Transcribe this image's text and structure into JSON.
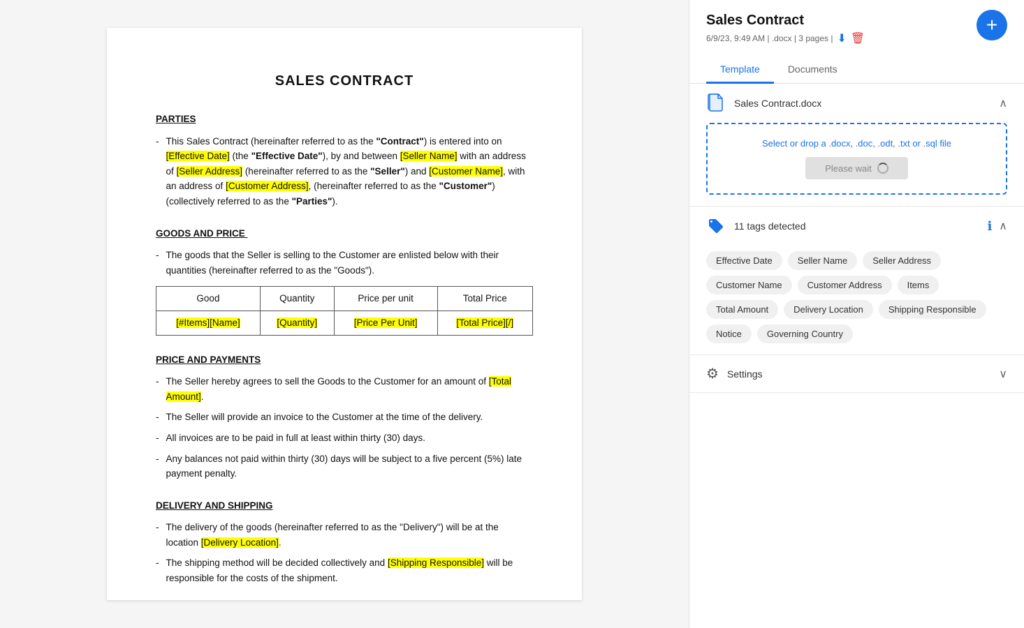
{
  "sidebar": {
    "title": "Sales Contract",
    "meta": "6/9/23, 9:49 AM | .docx | 3 pages |",
    "add_button_label": "+",
    "tabs": [
      {
        "id": "template",
        "label": "Template",
        "active": true
      },
      {
        "id": "documents",
        "label": "Documents",
        "active": false
      }
    ],
    "file_section": {
      "filename": "Sales Contract.docx",
      "upload_text": "Select or drop a .docx, .doc, .odt, .txt or .sql file",
      "wait_button": "Please wait"
    },
    "tags_section": {
      "count_label": "11 tags detected",
      "tags": [
        "Effective Date",
        "Seller Name",
        "Seller Address",
        "Customer Name",
        "Customer Address",
        "Items",
        "Total Amount",
        "Delivery Location",
        "Shipping Responsible",
        "Notice",
        "Governing Country"
      ]
    },
    "settings_section": {
      "label": "Settings"
    }
  },
  "document": {
    "title": "SALES CONTRACT",
    "sections": [
      {
        "heading": "PARTIES",
        "bullets": [
          {
            "text_parts": [
              {
                "text": "This Sales Contract (hereinafter referred to as the ",
                "highlight": false
              },
              {
                "text": "“Contract”",
                "highlight": false,
                "bold": true
              },
              {
                "text": ") is entered into on ",
                "highlight": false
              },
              {
                "text": "[Effective Date]",
                "highlight": true
              },
              {
                "text": " (the ",
                "highlight": false
              },
              {
                "text": "“Effective Date”",
                "highlight": false,
                "bold": true
              },
              {
                "text": "), by and between ",
                "highlight": false
              },
              {
                "text": "[Seller Name]",
                "highlight": true
              },
              {
                "text": " with an address of ",
                "highlight": false
              },
              {
                "text": "[Seller Address]",
                "highlight": true
              },
              {
                "text": " (hereinafter referred to as the ",
                "highlight": false
              },
              {
                "text": "“Seller”",
                "highlight": false,
                "bold": true
              },
              {
                "text": ") and ",
                "highlight": false
              },
              {
                "text": "[Customer Name]",
                "highlight": true
              },
              {
                "text": ", with an address of ",
                "highlight": false
              },
              {
                "text": "[Customer Address]",
                "highlight": true
              },
              {
                "text": ", (hereinafter referred to as the ",
                "highlight": false
              },
              {
                "text": "“Customer”",
                "highlight": false,
                "bold": true
              },
              {
                "text": ") (collectively referred to as the ",
                "highlight": false
              },
              {
                "text": "“Parties”",
                "highlight": false,
                "bold": true
              },
              {
                "text": ").",
                "highlight": false
              }
            ]
          }
        ]
      },
      {
        "heading": "GOODS AND PRICE",
        "bullets": [
          {
            "text_parts": [
              {
                "text": "The goods that the Seller is selling to the Customer are enlisted below with their quantities (hereinafter referred to as the “Goods”).",
                "highlight": false
              }
            ]
          }
        ],
        "table": {
          "headers": [
            "Good",
            "Quantity",
            "Price per unit",
            "Total Price"
          ],
          "rows": [
            [
              "[#Items][Name]",
              "[Quantity]",
              "[Price Per Unit]",
              "[Total Price][/]"
            ]
          ]
        }
      },
      {
        "heading": "PRICE AND PAYMENTS",
        "bullets": [
          {
            "text_parts": [
              {
                "text": "The Seller hereby agrees to sell the Goods to the Customer for an amount of ",
                "highlight": false
              },
              {
                "text": "[Total Amount]",
                "highlight": true
              },
              {
                "text": ".",
                "highlight": false
              }
            ]
          },
          {
            "text_parts": [
              {
                "text": "The Seller will provide an invoice to the Customer at the time of the delivery.",
                "highlight": false
              }
            ]
          },
          {
            "text_parts": [
              {
                "text": "All invoices are to be paid in full at least within thirty (30) days.",
                "highlight": false
              }
            ]
          },
          {
            "text_parts": [
              {
                "text": "Any balances not paid within thirty (30) days will be subject to a five percent (5%) late payment penalty.",
                "highlight": false
              }
            ]
          }
        ]
      },
      {
        "heading": "DELIVERY AND SHIPPING",
        "bullets": [
          {
            "text_parts": [
              {
                "text": "The delivery of the goods (hereinafter referred to as the “Delivery”) will be at the location ",
                "highlight": false
              },
              {
                "text": "[Delivery Location]",
                "highlight": true
              },
              {
                "text": ".",
                "highlight": false
              }
            ]
          },
          {
            "text_parts": [
              {
                "text": "The shipping method will be decided collectively and ",
                "highlight": false
              },
              {
                "text": "[Shipping Responsible]",
                "highlight": true
              },
              {
                "text": " will be responsible for the costs of the shipment.",
                "highlight": false
              }
            ]
          }
        ]
      }
    ]
  },
  "icons": {
    "chevron_up": "⌃",
    "chevron_down": "⌄",
    "download": "↓",
    "delete": "🗑",
    "info": "ⓘ",
    "gear": "⚙"
  }
}
